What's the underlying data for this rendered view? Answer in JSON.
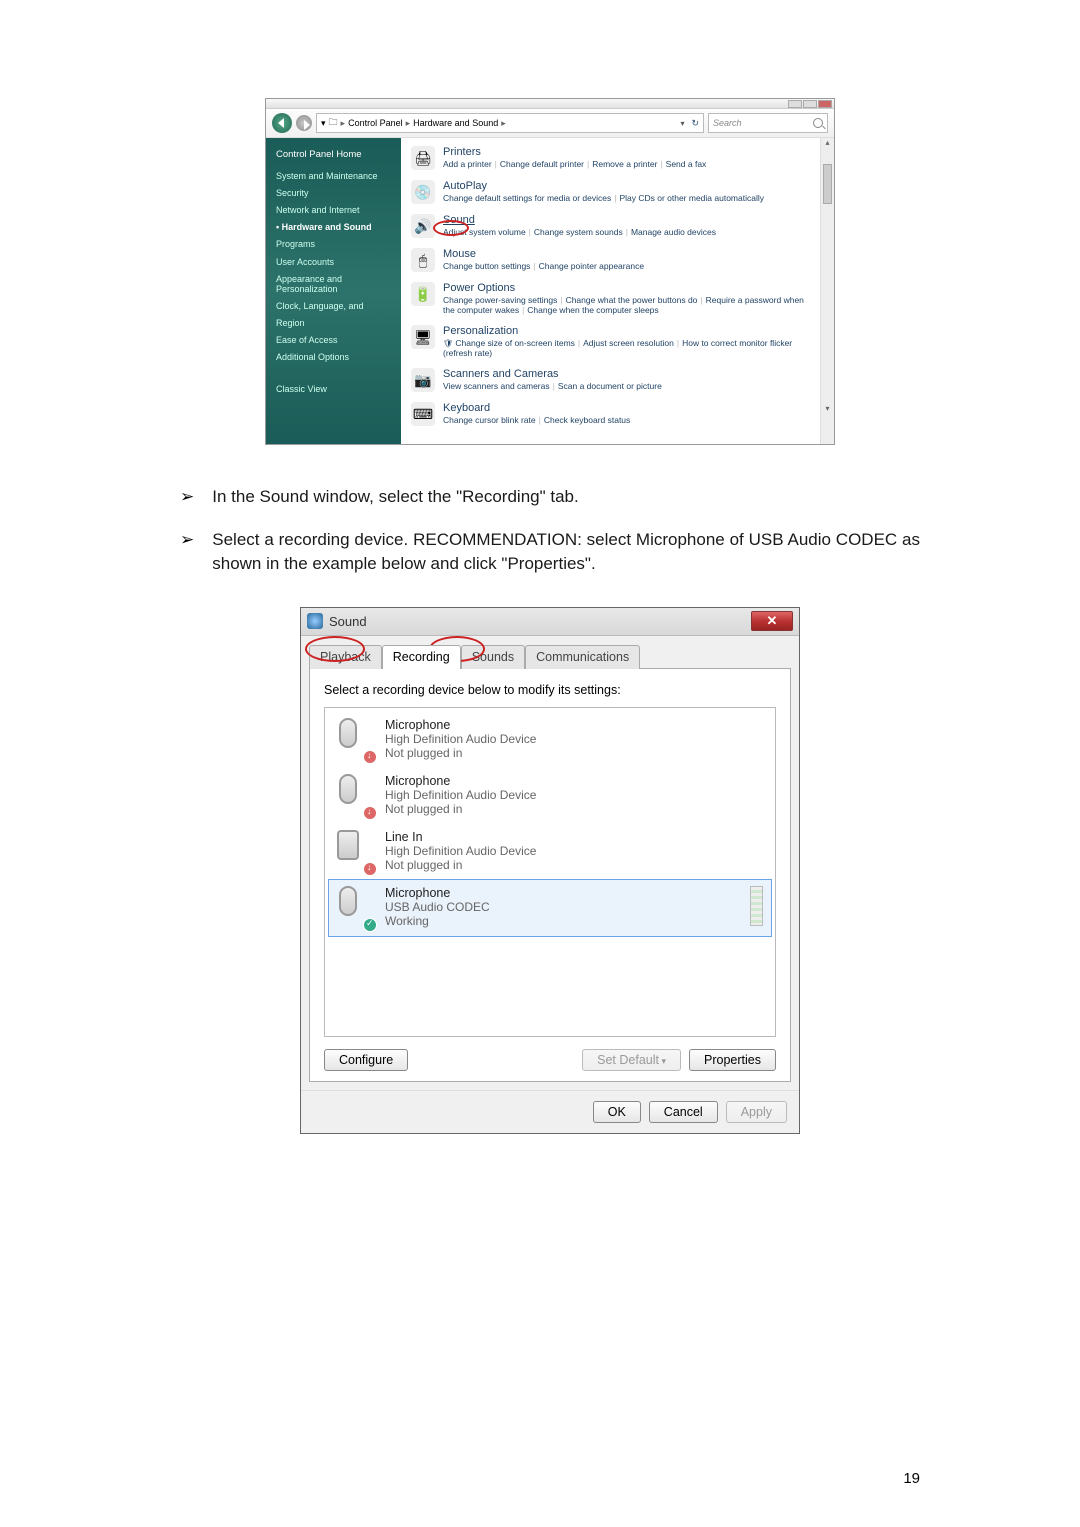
{
  "page_number": "19",
  "control_panel": {
    "breadcrumb": {
      "root_glyph": "▾",
      "folder_icon": "🗀",
      "p1": "Control Panel",
      "p2": "Hardware and Sound",
      "sep": "▸",
      "dd": "▾"
    },
    "refresh_glyph": "↻",
    "search_placeholder": "Search",
    "sidebar": {
      "home": "Control Panel Home",
      "items": [
        "System and Maintenance",
        "Security",
        "Network and Internet",
        "Hardware and Sound",
        "Programs",
        "User Accounts",
        "Appearance and Personalization",
        "Clock, Language, and Region",
        "Ease of Access",
        "Additional Options"
      ],
      "classic": "Classic View"
    },
    "categories": [
      {
        "icon": "🖨",
        "title": "Printers",
        "links": [
          "Add a printer",
          "Change default printer",
          "Remove a printer",
          "Send a fax"
        ]
      },
      {
        "icon": "💿",
        "title": "AutoPlay",
        "links": [
          "Change default settings for media or devices",
          "Play CDs or other media automatically"
        ]
      },
      {
        "icon": "🔊",
        "title": "Sound",
        "links": [
          "Adjust system volume",
          "Change system sounds",
          "Manage audio devices"
        ],
        "circled": true
      },
      {
        "icon": "🖱",
        "title": "Mouse",
        "links": [
          "Change button settings",
          "Change pointer appearance"
        ]
      },
      {
        "icon": "🔋",
        "title": "Power Options",
        "links": [
          "Change power-saving settings",
          "Change what the power buttons do",
          "Require a password when the computer wakes",
          "Change when the computer sleeps"
        ]
      },
      {
        "icon": "🖥",
        "title": "Personalization",
        "links": [
          "Change size of on-screen items",
          "Adjust screen resolution",
          "How to correct monitor flicker (refresh rate)"
        ],
        "shield_on_first": true
      },
      {
        "icon": "📷",
        "title": "Scanners and Cameras",
        "links": [
          "View scanners and cameras",
          "Scan a document or picture"
        ]
      },
      {
        "icon": "⌨",
        "title": "Keyboard",
        "links": [
          "Change cursor blink rate",
          "Check keyboard status"
        ]
      }
    ]
  },
  "instructions": [
    "In the Sound window, select the \"Recording\" tab.",
    "Select a recording device. RECOMMENDATION: select Microphone of USB Audio CODEC as shown in the example below and click \"Properties\"."
  ],
  "sound_dialog": {
    "title": "Sound",
    "close_glyph": "✕",
    "tabs": {
      "playback": "Playback",
      "recording": "Recording",
      "sounds": "Sounds",
      "communications": "Communications"
    },
    "prompt": "Select a recording device below to modify its settings:",
    "devices": [
      {
        "name": "Microphone",
        "sub": "High Definition Audio Device",
        "status": "Not plugged in",
        "badge": "np",
        "icon": "mic"
      },
      {
        "name": "Microphone",
        "sub": "High Definition Audio Device",
        "status": "Not plugged in",
        "badge": "np",
        "icon": "mic"
      },
      {
        "name": "Line In",
        "sub": "High Definition Audio Device",
        "status": "Not plugged in",
        "badge": "np",
        "icon": "jack"
      },
      {
        "name": "Microphone",
        "sub": "USB Audio CODEC",
        "status": "Working",
        "badge": "ok",
        "icon": "mic",
        "selected": true,
        "meter": true
      }
    ],
    "buttons": {
      "configure": "Configure",
      "set_default": "Set Default",
      "properties": "Properties",
      "ok": "OK",
      "cancel": "Cancel",
      "apply": "Apply"
    }
  }
}
